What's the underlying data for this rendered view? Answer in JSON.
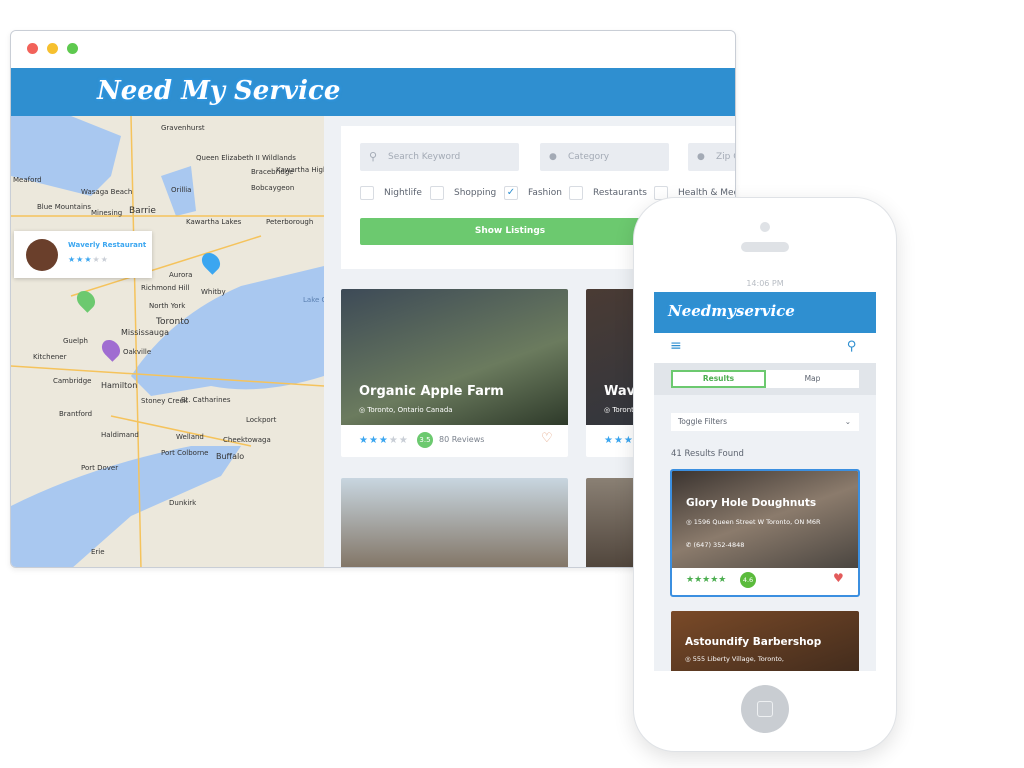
{
  "desktop": {
    "logo": "Need My Service",
    "search": {
      "keyword_placeholder": "Search Keyword",
      "category_placeholder": "Category",
      "zip_placeholder": "Zip Code"
    },
    "filters": [
      {
        "label": "Nightlife",
        "checked": false
      },
      {
        "label": "Shopping",
        "checked": false
      },
      {
        "label": "Fashion",
        "checked": true
      },
      {
        "label": "Restaurants",
        "checked": false
      },
      {
        "label": "Health & Medical",
        "checked": false
      }
    ],
    "show_button": "Show Listings",
    "map": {
      "popup": {
        "name": "Waverly Restaurant",
        "rating": 3
      },
      "places": [
        "Gravenhurst",
        "Meaford",
        "Wasaga Beach",
        "Blue Mountains",
        "Minesing",
        "Barrie",
        "Bracebridge",
        "Queen Elizabeth II Wildlands",
        "Kawartha Highlands",
        "Bobcaygeon",
        "Kawartha Lakes",
        "Peterborough",
        "Orillia",
        "Aurora",
        "Whitby",
        "Richmond Hill",
        "North York",
        "Toronto",
        "Mississauga",
        "Oakville",
        "Guelph",
        "Kitchener",
        "Cambridge",
        "Hamilton",
        "Brantford",
        "St. Catharines",
        "Stoney Creek",
        "Welland",
        "Haldimand",
        "Lockport",
        "Buffalo",
        "Port Colborne",
        "Cheektowaga",
        "Port Dover",
        "Dunkirk",
        "Erie",
        "Lake Ontario"
      ]
    },
    "listings": [
      {
        "title": "Organic Apple Farm",
        "location": "Toronto, Ontario Canada",
        "rating": 3,
        "score": "3.5",
        "reviews": "80 Reviews"
      },
      {
        "title": "Waverly Restaurant",
        "location": "Toronto",
        "rating": 3
      }
    ]
  },
  "mobile": {
    "status": {
      "time": "14:06 PM"
    },
    "logo": "Needmyservice",
    "tabs": [
      "Results",
      "Map"
    ],
    "toggle_filters": "Toggle Filters",
    "results_count": "41 Results Found",
    "results": [
      {
        "title": "Glory Hole Doughnuts",
        "address": "1596 Queen Street W Toronto, ON M6R",
        "phone": "(647) 352-4848",
        "rating": 5,
        "score": "4.6"
      },
      {
        "title": "Astoundify Barbershop",
        "address": "555 Liberty Village, Toronto,"
      }
    ]
  },
  "colors": {
    "brand": "#2f8fd0",
    "green": "#6cc96f",
    "star": "#3ba6f0"
  }
}
